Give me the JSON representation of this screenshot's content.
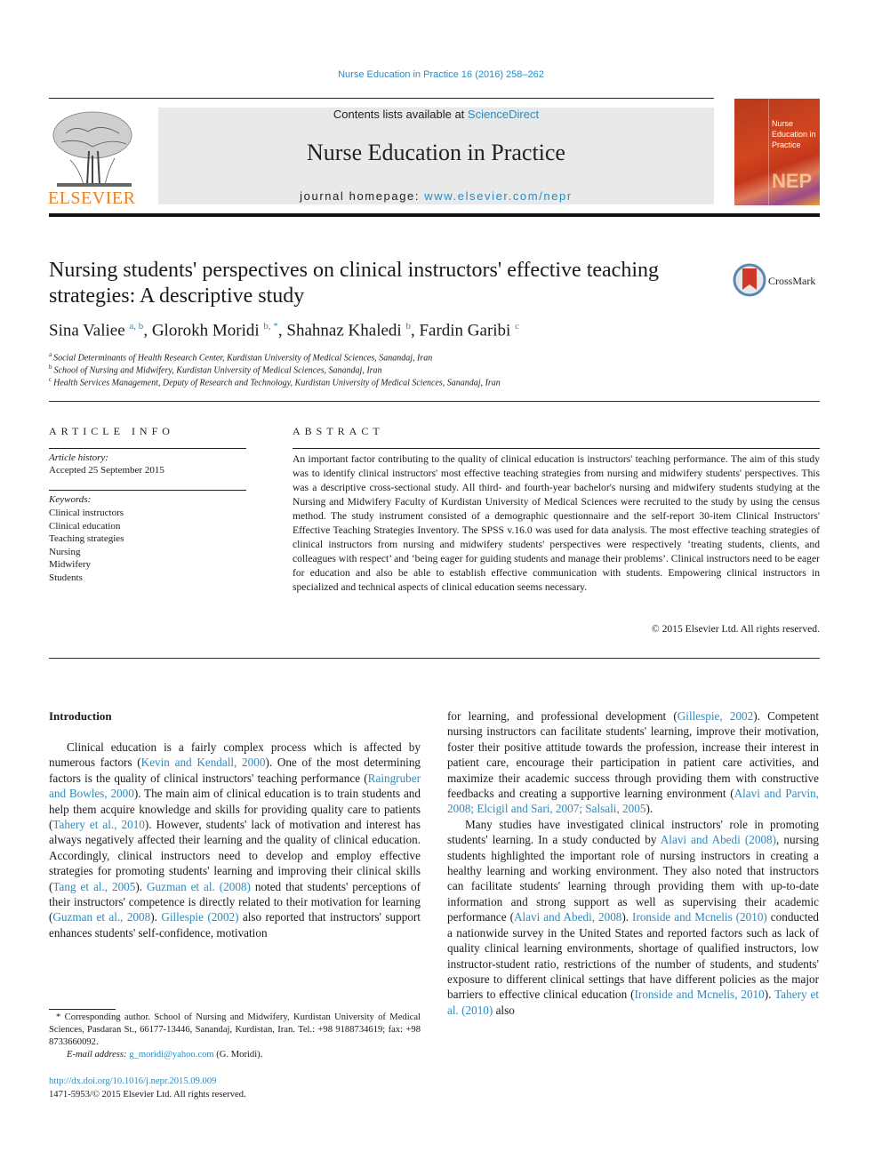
{
  "header": {
    "citation": "Nurse Education in Practice 16 (2016) 258–262",
    "contents_prefix": "Contents lists available at ",
    "contents_link": "ScienceDirect",
    "journal_title": "Nurse Education in Practice",
    "homepage_prefix": "journal homepage: ",
    "homepage_link": "www.elsevier.com/nepr",
    "publisher_logo_text": "ELSEVIER",
    "cover": {
      "title_line1": "Nurse",
      "title_line2": "Education in",
      "title_line3": "Practice",
      "abbr": "NEP"
    }
  },
  "article": {
    "title": "Nursing students' perspectives on clinical instructors' effective teaching strategies: A descriptive study",
    "crossmark_label": "CrossMark",
    "authors": [
      {
        "name": "Sina Valiee",
        "sup": "a, b"
      },
      {
        "name": "Glorokh Moridi",
        "sup": "b, *"
      },
      {
        "name": "Shahnaz Khaledi",
        "sup": "b"
      },
      {
        "name": "Fardin Garibi",
        "sup": "c"
      }
    ],
    "affiliations": [
      {
        "mark": "a",
        "text": "Social Determinants of Health Research Center, Kurdistan University of Medical Sciences, Sanandaj, Iran"
      },
      {
        "mark": "b",
        "text": "School of Nursing and Midwifery, Kurdistan University of Medical Sciences, Sanandaj, Iran"
      },
      {
        "mark": "c",
        "text": "Health Services Management, Deputy of Research and Technology, Kurdistan University of Medical Sciences, Sanandaj, Iran"
      }
    ]
  },
  "article_info": {
    "heading": "ARTICLE INFO",
    "history_label": "Article history:",
    "history_value": "Accepted 25 September 2015",
    "keywords_label": "Keywords:",
    "keywords": [
      "Clinical instructors",
      "Clinical education",
      "Teaching strategies",
      "Nursing",
      "Midwifery",
      "Students"
    ]
  },
  "abstract": {
    "heading": "ABSTRACT",
    "text": "An important factor contributing to the quality of clinical education is instructors' teaching performance. The aim of this study was to identify clinical instructors' most effective teaching strategies from nursing and midwifery students' perspectives. This was a descriptive cross-sectional study. All third- and fourth-year bachelor's nursing and midwifery students studying at the Nursing and Midwifery Faculty of Kurdistan University of Medical Sciences were recruited to the study by using the census method. The study instrument consisted of a demographic questionnaire and the self-report 30-item Clinical Instructors' Effective Teaching Strategies Inventory. The SPSS v.16.0 was used for data analysis. The most effective teaching strategies of clinical instructors from nursing and midwifery students' perspectives were respectively ‘treating students, clients, and colleagues with respect’ and ‘being eager for guiding students and manage their problems’. Clinical instructors need to be eager for education and also be able to establish effective communication with students. Empowering clinical instructors in specialized and technical aspects of clinical education seems necessary.",
    "copyright": "© 2015 Elsevier Ltd. All rights reserved."
  },
  "body": {
    "intro_heading": "Introduction",
    "p1": [
      {
        "t": "Clinical education is a fairly complex process which is affected by numerous factors ("
      },
      {
        "l": "Kevin and Kendall, 2000"
      },
      {
        "t": "). One of the most determining factors is the quality of clinical instructors' teaching performance ("
      },
      {
        "l": "Raingruber and Bowles, 2000"
      },
      {
        "t": "). The main aim of clinical education is to train students and help them acquire knowledge and skills for providing quality care to patients ("
      },
      {
        "l": "Tahery et al., 2010"
      },
      {
        "t": "). However, students' lack of motivation and interest has always negatively affected their learning and the quality of clinical education. Accordingly, clinical instructors need to develop and employ effective strategies for promoting students' learning and improving their clinical skills ("
      },
      {
        "l": "Tang et al., 2005"
      },
      {
        "t": "). "
      },
      {
        "l": "Guzman et al. (2008)"
      },
      {
        "t": " noted that students' perceptions of their instructors' competence is directly related to their motivation for learning ("
      },
      {
        "l": "Guzman et al., 2008"
      },
      {
        "t": "). "
      },
      {
        "l": "Gillespie (2002)"
      },
      {
        "t": " also reported that in­structors' support enhances students' self-confidence, motivation"
      }
    ],
    "p1_cont": [
      {
        "t": "for learning, and professional development ("
      },
      {
        "l": "Gillespie, 2002"
      },
      {
        "t": "). Competent nursing instructors can facilitate students' learning, improve their motivation, foster their positive attitude towards the profession, increase their interest in patient care, encourage their participation in patient care activities, and maximize their aca­demic success through providing them with constructive feedbacks and creating a supportive learning environment ("
      },
      {
        "l": "Alavi and Parvin, 2008; Elcigil and Sari, 2007; Salsali, 2005"
      },
      {
        "t": ")."
      }
    ],
    "p2": [
      {
        "t": "Many studies have investigated clinical instructors' role in pro­moting students' learning. In a study conducted by "
      },
      {
        "l": "Alavi and Abedi (2008)"
      },
      {
        "t": ", nursing students highlighted the important role of nursing instructors in creating a healthy learning and working environ­ment. They also noted that instructors can facilitate students' learning through providing them with up-to-date information and strong support as well as supervising their academic performance ("
      },
      {
        "l": "Alavi and Abedi, 2008"
      },
      {
        "t": "). "
      },
      {
        "l": "Ironside and Mcnelis (2010)"
      },
      {
        "t": " conducted a nationwide survey in the United States and reported factors such as lack of quality clinical learning environments, shortage of qualified instructors, low instructor-student ratio, restrictions of the number of students, and students' exposure to different clinical settings that have different policies as the major barriers to effective clinical education ("
      },
      {
        "l": "Ironside and Mcnelis, 2010"
      },
      {
        "t": "). "
      },
      {
        "l": "Tahery et al. (2010)"
      },
      {
        "t": " also"
      }
    ]
  },
  "footnotes": {
    "corresponding": "* Corresponding author. School of Nursing and Midwifery, Kurdistan University of Medical Sciences, Pasdaran St., 66177-13446, Sanandaj, Kurdistan, Iran. Tel.: +98 9188734619; fax: +98 8733660092.",
    "email_label": "E-mail address: ",
    "email": "g_moridi@yahoo.com",
    "email_suffix": " (G. Moridi).",
    "doi": "http://dx.doi.org/10.1016/j.nepr.2015.09.009",
    "issn": "1471-5953/© 2015 Elsevier Ltd. All rights reserved."
  },
  "colors": {
    "link": "#2e8bc0",
    "elsevier_orange": "#f07f1e",
    "header_box": "#e9e9e9"
  }
}
